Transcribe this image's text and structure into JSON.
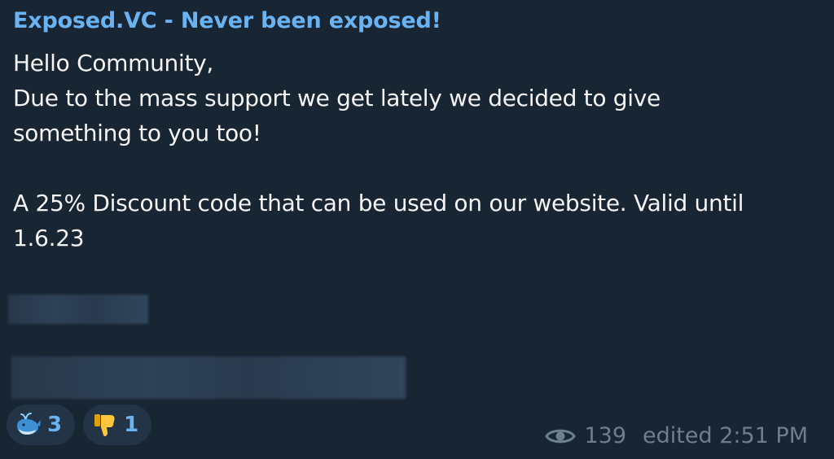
{
  "message": {
    "sender": "Exposed.VC - Never been exposed!",
    "lines": [
      "Hello Community,",
      "Due to the mass support we get lately we decided to give",
      "something to you too!",
      "",
      "A 25% Discount code that can be used on our website. Valid until",
      "1.6.23"
    ]
  },
  "reactions": [
    {
      "icon": "whale-icon",
      "count": "3"
    },
    {
      "icon": "thumbs-down-icon",
      "count": "1"
    }
  ],
  "meta": {
    "views_icon": "eye-icon",
    "views": "139",
    "edited_label": "edited 2:51 PM"
  },
  "colors": {
    "background": "#182533",
    "accent": "#6ab3f3",
    "text": "#f5f5f5",
    "muted": "#6d7f8f"
  }
}
